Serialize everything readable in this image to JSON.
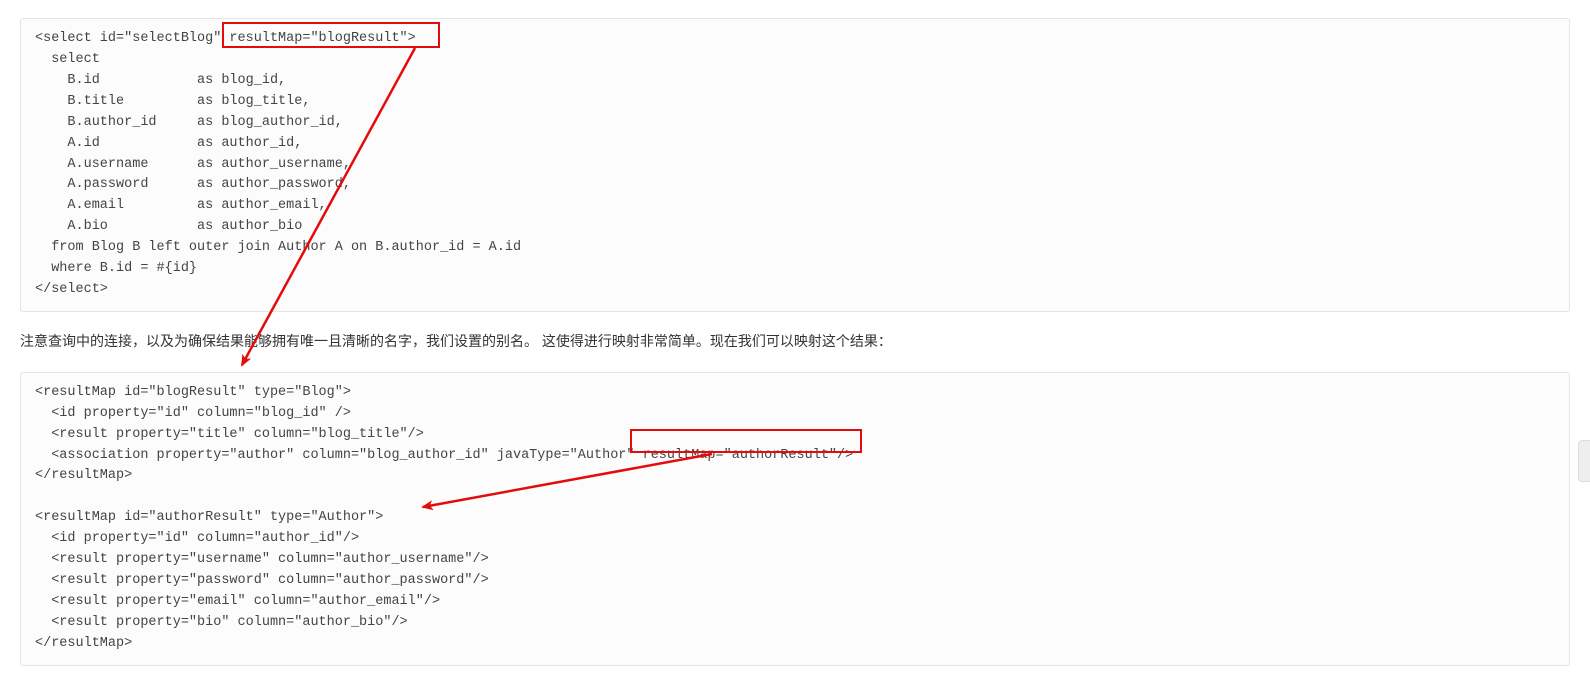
{
  "code1": "<select id=\"selectBlog\" resultMap=\"blogResult\">\n  select\n    B.id            as blog_id,\n    B.title         as blog_title,\n    B.author_id     as blog_author_id,\n    A.id            as author_id,\n    A.username      as author_username,\n    A.password      as author_password,\n    A.email         as author_email,\n    A.bio           as author_bio\n  from Blog B left outer join Author A on B.author_id = A.id\n  where B.id = #{id}\n</select>",
  "para1": "注意查询中的连接，以及为确保结果能够拥有唯一且清晰的名字，我们设置的别名。 这使得进行映射非常简单。现在我们可以映射这个结果：",
  "code2": "<resultMap id=\"blogResult\" type=\"Blog\">\n  <id property=\"id\" column=\"blog_id\" />\n  <result property=\"title\" column=\"blog_title\"/>\n  <association property=\"author\" column=\"blog_author_id\" javaType=\"Author\" resultMap=\"authorResult\"/>\n</resultMap>\n\n<resultMap id=\"authorResult\" type=\"Author\">\n  <id property=\"id\" column=\"author_id\"/>\n  <result property=\"username\" column=\"author_username\"/>\n  <result property=\"password\" column=\"author_password\"/>\n  <result property=\"email\" column=\"author_email\"/>\n  <result property=\"bio\" column=\"author_bio\"/>\n</resultMap>",
  "annotations": {
    "box1": {
      "highlight": "resultMap=\"blogResult\""
    },
    "box2": {
      "highlight": "resultMap=\"authorResult\""
    }
  }
}
